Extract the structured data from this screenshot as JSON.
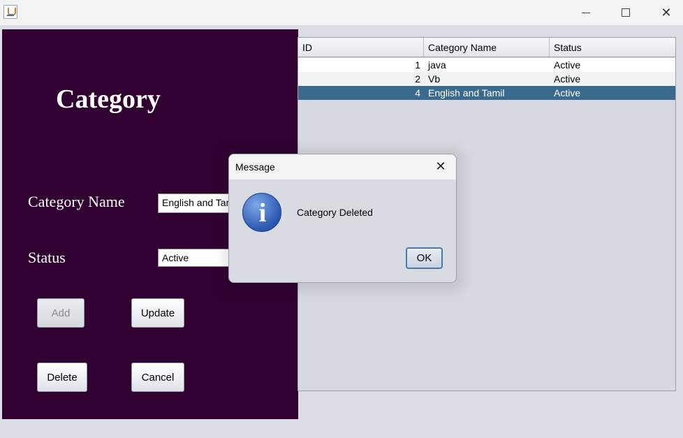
{
  "window": {
    "icon": "java-cup-icon",
    "controls": {
      "minimize": "",
      "maximize": "",
      "close": "✕"
    }
  },
  "form": {
    "title": "Category",
    "category_name_label": "Category Name",
    "status_label": "Status",
    "category_name_value": "English and Tamil",
    "status_value": "Active",
    "buttons": {
      "add": "Add",
      "update": "Update",
      "delete": "Delete",
      "cancel": "Cancel"
    }
  },
  "table": {
    "columns": [
      "ID",
      "Category Name",
      "Status"
    ],
    "rows": [
      {
        "id": "1",
        "name": "java",
        "status": "Active"
      },
      {
        "id": "2",
        "name": "Vb",
        "status": "Active"
      },
      {
        "id": "4",
        "name": "English and Tamil",
        "status": "Active",
        "selected": true
      }
    ]
  },
  "dialog": {
    "title": "Message",
    "close": "✕",
    "icon": "info-icon",
    "icon_glyph": "i",
    "message": "Category Deleted",
    "ok_label": "OK"
  },
  "colors": {
    "panel_bg": "#300030",
    "selected_row": "#3a6a8e",
    "window_bg": "#dadde3"
  }
}
